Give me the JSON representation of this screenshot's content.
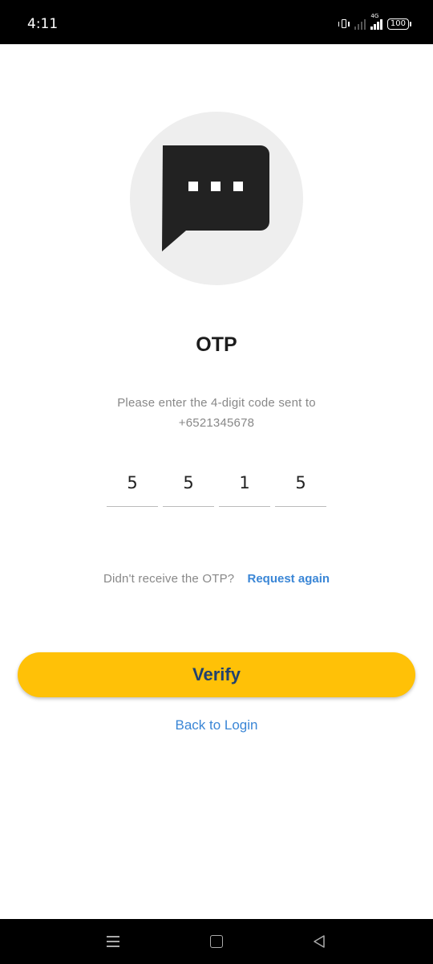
{
  "status_bar": {
    "time": "4:11",
    "network_label": "4G",
    "battery": "100"
  },
  "illustration": {
    "icon": "chat-bubble-dots-icon",
    "circle_color": "#eeeeee",
    "bubble_color": "#222222"
  },
  "page": {
    "title": "OTP",
    "instruction_line1": "Please enter the 4-digit code sent to",
    "phone": "+6521345678"
  },
  "otp": {
    "digits": [
      "5",
      "5",
      "1",
      "5"
    ]
  },
  "resend": {
    "prompt": "Didn't receive the OTP?",
    "link": "Request again"
  },
  "actions": {
    "verify_label": "Verify",
    "back_label": "Back to Login"
  },
  "colors": {
    "accent": "#ffc107",
    "verify_text": "#22426e",
    "link": "#3a86d6"
  },
  "nav_bar": {
    "icons": [
      "menu-icon",
      "home-icon",
      "back-icon"
    ]
  }
}
